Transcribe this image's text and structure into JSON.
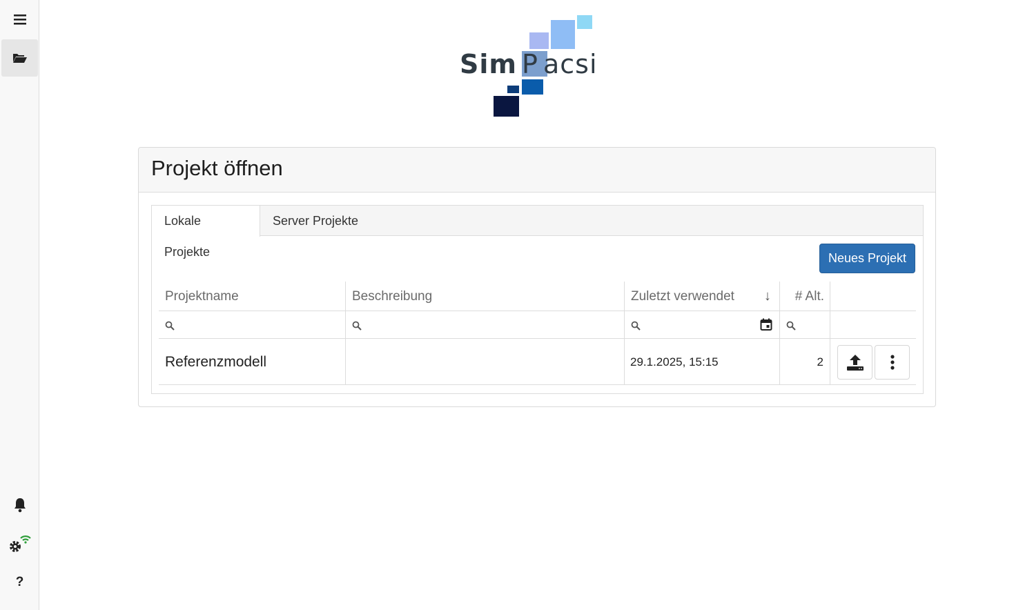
{
  "sidebar": {
    "top_items": [
      {
        "icon": "hamburger-menu-icon"
      },
      {
        "icon": "folder-open-icon",
        "active": true
      }
    ],
    "bottom_items": [
      {
        "icon": "bell-icon"
      },
      {
        "icon": "gear-wifi-icon"
      },
      {
        "icon": "help-icon",
        "label": "?"
      }
    ]
  },
  "logo": {
    "text": "SimPacsi",
    "colors": [
      "#8fd8f5",
      "#8fbdf5",
      "#a9b8f2",
      "#0a5cab",
      "#0d3d7a",
      "#0a1640"
    ]
  },
  "card": {
    "title": "Projekt öffnen"
  },
  "tabs": [
    {
      "label": "Lokale Projekte",
      "active": true
    },
    {
      "label": "Server Projekte",
      "active": false
    }
  ],
  "actions": {
    "new_project": "Neues Projekt"
  },
  "table": {
    "columns": [
      {
        "label": "Projektname"
      },
      {
        "label": "Beschreibung"
      },
      {
        "label": "Zuletzt verwendet",
        "sort": "↓"
      },
      {
        "label": "# Alt."
      },
      {
        "label": ""
      }
    ],
    "rows": [
      {
        "name": "Referenzmodell",
        "description": "",
        "last_used": "29.1.2025, 15:15",
        "alternatives": "2"
      }
    ]
  },
  "colors": {
    "primary": "#2c6fb3",
    "sidebar_bg": "#f8f8f8",
    "wifi_green": "#2e9e3a"
  }
}
